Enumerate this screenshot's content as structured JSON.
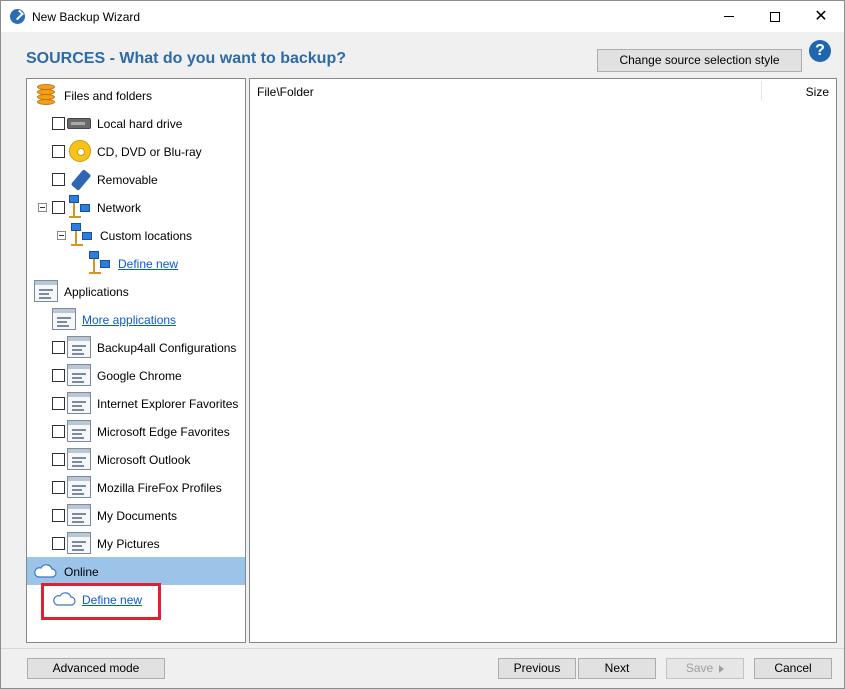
{
  "window": {
    "title": "New Backup Wizard"
  },
  "header": {
    "heading": "SOURCES - What do you want to backup?",
    "change_style_label": "Change source selection style",
    "help_glyph": "?"
  },
  "tree": {
    "files_and_folders": "Files and folders",
    "local_hard_drive": "Local hard drive",
    "cd_dvd": "CD, DVD or Blu-ray",
    "removable": "Removable",
    "network": "Network",
    "custom_locations": "Custom locations",
    "network_define_new": "Define new",
    "applications": "Applications",
    "more_applications": "More applications",
    "apps": [
      "Backup4all Configurations",
      "Google Chrome",
      "Internet Explorer Favorites",
      "Microsoft Edge Favorites",
      "Microsoft Outlook",
      "Mozilla FireFox Profiles",
      "My Documents",
      "My Pictures"
    ],
    "online": "Online",
    "online_define_new": "Define new"
  },
  "list": {
    "col_file_folder": "File\\Folder",
    "col_size": "Size"
  },
  "footer": {
    "advanced_mode": "Advanced mode",
    "previous": "Previous",
    "next": "Next",
    "save": "Save",
    "cancel": "Cancel"
  },
  "colors": {
    "heading": "#2c6aa8",
    "selected_row": "#9cc4e8",
    "link": "#0a5bd0",
    "highlight": "#e02030"
  }
}
